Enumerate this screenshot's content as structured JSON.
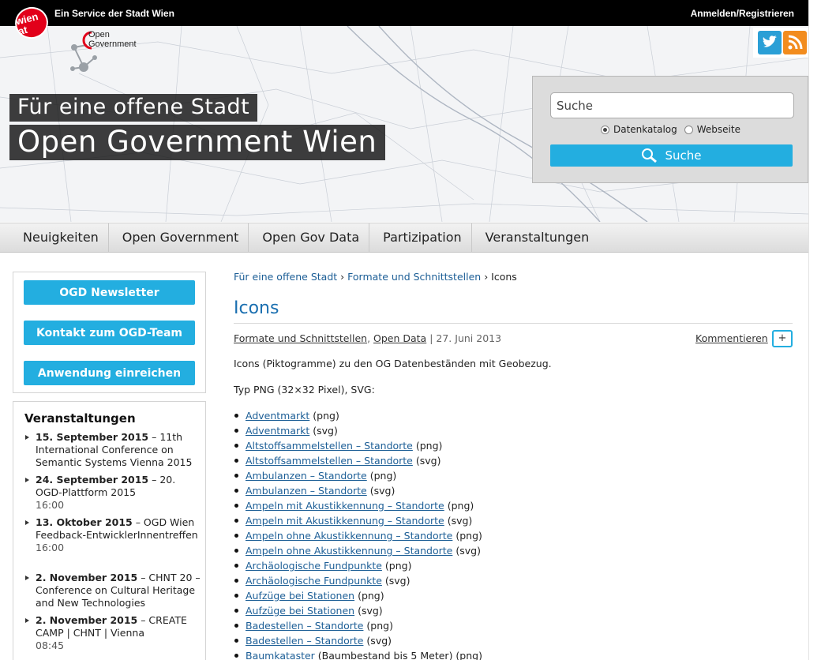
{
  "topbar": {
    "logo_text": "wien at",
    "service_text": "Ein Service der Stadt Wien",
    "login_label": "Anmelden/Registrieren"
  },
  "header": {
    "og_logo_line1": "Open",
    "og_logo_line2": "Government",
    "tagline": "Für eine offene Stadt",
    "site_title": "Open Government Wien",
    "social": {
      "twitter_icon": "twitter-icon",
      "rss_icon": "rss-icon"
    }
  },
  "search": {
    "placeholder": "Suche",
    "radio_options": [
      {
        "label": "Datenkatalog",
        "selected": true
      },
      {
        "label": "Webseite",
        "selected": false
      }
    ],
    "button_label": "Suche",
    "button_icon": "search-icon",
    "accent_color": "#23aee0"
  },
  "nav": {
    "items": [
      {
        "label": "Neuigkeiten"
      },
      {
        "label": "Open Government"
      },
      {
        "label": "Open Gov Data"
      },
      {
        "label": "Partizipation"
      },
      {
        "label": "Veranstaltungen"
      }
    ]
  },
  "sidebar": {
    "buttons": [
      {
        "label": "OGD Newsletter"
      },
      {
        "label": "Kontakt zum OGD-Team"
      },
      {
        "label": "Anwendung einreichen"
      }
    ],
    "events_title": "Veranstaltungen",
    "events": [
      {
        "date": "15. September 2015",
        "text": " – 11th International Conference on Semantic Systems Vienna 2015",
        "time": ""
      },
      {
        "date": "24. September 2015",
        "text": " – 20. OGD-Plattform 2015",
        "time": "16:00"
      },
      {
        "date": "13. Oktober 2015",
        "text": " – OGD Wien Feedback-EntwicklerInnentreffen",
        "time": "16:00"
      },
      {
        "date": "2. November 2015",
        "text": " – CHNT 20 – Conference on Cultural Heritage and New Technologies",
        "time": ""
      },
      {
        "date": "2. November 2015",
        "text": " – CREATE CAMP | CHNT | Vienna",
        "time": "08:45"
      }
    ]
  },
  "main": {
    "breadcrumb": {
      "crumb1": "Für eine offene Stadt",
      "crumb2": "Formate und Schnittstellen",
      "current": "Icons",
      "separator": "›"
    },
    "title": "Icons",
    "meta": {
      "category1": "Formate und Schnittstellen",
      "category2": "Open Data",
      "date": "27. Juni 2013"
    },
    "comment_label": "Kommentieren",
    "comment_plus": "+",
    "intro": "Icons (Piktogramme) zu den OG Datenbeständen mit Geobezug.",
    "typeline": "Typ PNG (32×32 Pixel), SVG:",
    "items": [
      {
        "link": "Adventmarkt",
        "suffix": " (png)"
      },
      {
        "link": "Adventmarkt",
        "suffix": " (svg)"
      },
      {
        "link": "Altstoffsammelstellen – Standorte",
        "suffix": " (png)"
      },
      {
        "link": "Altstoffsammelstellen – Standorte",
        "suffix": " (svg)"
      },
      {
        "link": "Ambulanzen – Standorte",
        "suffix": " (png)"
      },
      {
        "link": "Ambulanzen – Standorte",
        "suffix": " (svg)"
      },
      {
        "link": "Ampeln mit Akustikkennung – Standorte",
        "suffix": " (png)"
      },
      {
        "link": "Ampeln mit Akustikkennung – Standorte",
        "suffix": " (svg)"
      },
      {
        "link": "Ampeln ohne Akustikkennung – Standorte",
        "suffix": " (png)"
      },
      {
        "link": "Ampeln ohne Akustikkennung – Standorte",
        "suffix": " (svg)"
      },
      {
        "link": "Archäologische Fundpunkte",
        "suffix": " (png)"
      },
      {
        "link": "Archäologische Fundpunkte",
        "suffix": " (svg)"
      },
      {
        "link": "Aufzüge bei Stationen",
        "suffix": " (png)"
      },
      {
        "link": "Aufzüge bei Stationen",
        "suffix": " (svg)"
      },
      {
        "link": "Badestellen – Standorte",
        "suffix": " (png)"
      },
      {
        "link": "Badestellen – Standorte",
        "suffix": " (svg)"
      },
      {
        "link": "Baumkataster",
        "suffix": " (Baumbestand bis 5 Meter) (png)"
      }
    ]
  }
}
